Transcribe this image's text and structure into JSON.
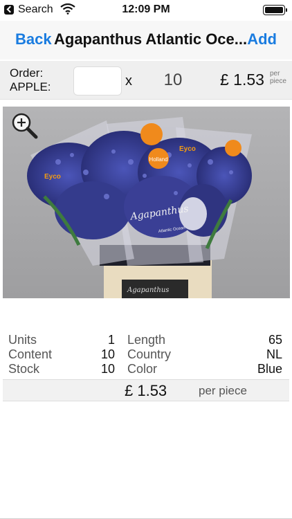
{
  "status_bar": {
    "back_app": "Search",
    "time": "12:09 PM"
  },
  "nav": {
    "back_label": "Back",
    "title": "Agapanthus Atlantic Oce...",
    "add_label": "Add"
  },
  "order": {
    "label": "Order: APPLE:",
    "quantity_value": "",
    "multiplier": "x",
    "pack_qty": "10",
    "price": "£ 1.53",
    "per_label": "per piece"
  },
  "image": {
    "zoom_icon": "zoom-in-icon",
    "sleeve_brand": "Eyco",
    "sticker_text": "Holland",
    "product_script": "Agapanthus",
    "sleeve_caption": "Atlantic Ocean"
  },
  "details": {
    "units_label": "Units",
    "units_value": "1",
    "content_label": "Content",
    "content_value": "10",
    "stock_label": "Stock",
    "stock_value": "10",
    "length_label": "Length",
    "length_value": "65",
    "country_label": "Country",
    "country_value": "NL",
    "color_label": "Color",
    "color_value": "Blue"
  },
  "price_row": {
    "price": "£ 1.53",
    "per_label": "per piece"
  },
  "colors": {
    "accent": "#1a7ce0",
    "bar_bg": "#efefef"
  }
}
